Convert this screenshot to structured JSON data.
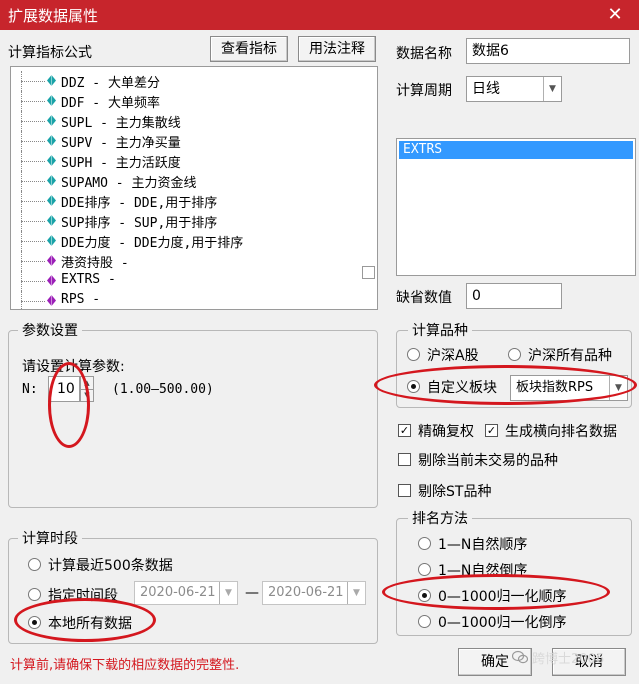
{
  "window": {
    "title": "扩展数据属性",
    "close_glyph": "✕"
  },
  "formula_panel": {
    "label": "计算指标公式",
    "view_button": "查看指标",
    "usage_button": "用法注释",
    "items": [
      {
        "text": "DDZ - 大单差分",
        "icon": "teal-gem-icon"
      },
      {
        "text": "DDF - 大单频率",
        "icon": "teal-gem-icon"
      },
      {
        "text": "SUPL - 主力集散线",
        "icon": "teal-gem-icon"
      },
      {
        "text": "SUPV - 主力净买量",
        "icon": "teal-gem-icon"
      },
      {
        "text": "SUPH - 主力活跃度",
        "icon": "teal-gem-icon"
      },
      {
        "text": "SUPAMO - 主力资金线",
        "icon": "teal-gem-icon"
      },
      {
        "text": "DDE排序 - DDE,用于排序",
        "icon": "teal-gem-icon"
      },
      {
        "text": "SUP排序 - SUP,用于排序",
        "icon": "teal-gem-icon"
      },
      {
        "text": "DDE力度 - DDE力度,用于排序",
        "icon": "teal-gem-icon"
      },
      {
        "text": "港资持股 -",
        "icon": "purple-gem-icon"
      },
      {
        "text": "EXTRS -",
        "icon": "purple-gem-icon"
      },
      {
        "text": "RPS -",
        "icon": "purple-gem-icon"
      }
    ]
  },
  "data_name": {
    "label": "数据名称",
    "value": "数据6"
  },
  "calc_period": {
    "label": "计算周期",
    "value": "日线"
  },
  "selected_list": {
    "items": [
      "EXTRS"
    ]
  },
  "default_value": {
    "label": "缺省数值",
    "value": "0"
  },
  "params": {
    "group_title": "参数设置",
    "prompt": "请设置计算参数:",
    "n_label": "N:",
    "n_value": "10",
    "n_range": "(1.00—500.00)"
  },
  "calc_variety": {
    "group_title": "计算品种",
    "opt_a": "沪深A股",
    "opt_all": "沪深所有品种",
    "opt_custom": "自定义板块",
    "custom_block": "板块指数RPS",
    "selected": "opt_custom"
  },
  "checks": {
    "fq": "精确复权",
    "cross": "生成横向排名数据",
    "exclude_untraded": "剔除当前未交易的品种",
    "exclude_st": "剔除ST品种",
    "fq_on": true,
    "cross_on": true,
    "untraded_on": false,
    "st_on": false
  },
  "rank": {
    "group_title": "排名方法",
    "o1": "1—N自然顺序",
    "o2": "1—N自然倒序",
    "o3": "0—1000归一化顺序",
    "o4": "0—1000归一化倒序",
    "selected": "o3"
  },
  "period": {
    "group_title": "计算时段",
    "recent": "计算最近500条数据",
    "range": "指定时间段",
    "date_from": "2020-06-21",
    "dash": "—",
    "date_to": "2020-06-21",
    "all": "本地所有数据",
    "selected": "all"
  },
  "warning": "计算前,请确保下载的相应数据的完整性.",
  "ok_button": "确定",
  "cancel_button": "取消",
  "watermark": "跨博士2006",
  "colors": {
    "title_bg": "#c7252c",
    "warning": "#d4171e",
    "selection": "#3399ff",
    "annotation": "#d4171e",
    "teal_gem": "#1aa3a8",
    "purple_gem": "#9b1fb8"
  }
}
